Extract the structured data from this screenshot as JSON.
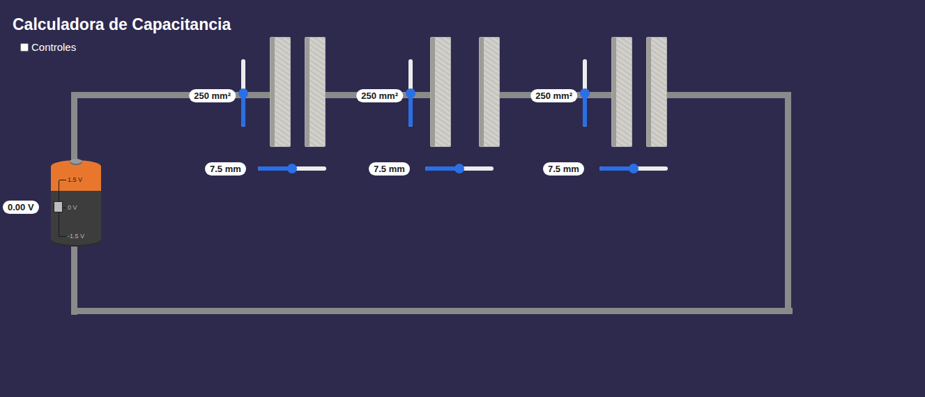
{
  "title": "Calculadora de Capacitancia",
  "controls": {
    "label": "Controles",
    "checked": false
  },
  "battery": {
    "reading": "0.00 V",
    "level": 0.5,
    "marks": [
      "1.5 V",
      "0 V",
      "-1.5 V"
    ]
  },
  "capacitors": [
    {
      "area": {
        "reading": "250 mm²",
        "level": 0.5
      },
      "distance": {
        "reading": "7.5 mm",
        "level": 0.5
      }
    },
    {
      "area": {
        "reading": "250 mm²",
        "level": 0.5
      },
      "distance": {
        "reading": "7.5 mm",
        "level": 0.5
      }
    },
    {
      "area": {
        "reading": "250 mm²",
        "level": 0.5
      },
      "distance": {
        "reading": "7.5 mm",
        "level": 0.5
      }
    }
  ]
}
